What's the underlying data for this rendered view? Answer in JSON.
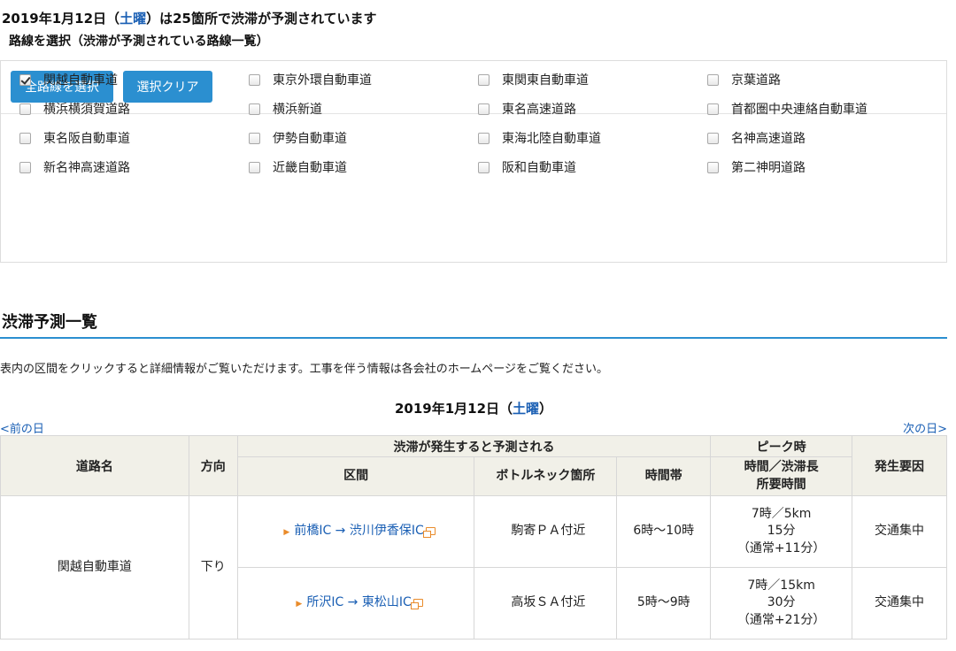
{
  "header": {
    "date_text": "2019年1月12日（",
    "day_of_week": "土曜",
    "summary": "）は25箇所で渋滞が予測されています",
    "subtitle": "路線を選択（渋滞が予測されている路線一覧）"
  },
  "route_select": {
    "select_all_label": "全路線を選択",
    "clear_label": "選択クリア",
    "routes": [
      {
        "label": "関越自動車道",
        "checked": true
      },
      {
        "label": "東京外環自動車道",
        "checked": false
      },
      {
        "label": "東関東自動車道",
        "checked": false
      },
      {
        "label": "京葉道路",
        "checked": false
      },
      {
        "label": "横浜横須賀道路",
        "checked": false
      },
      {
        "label": "横浜新道",
        "checked": false
      },
      {
        "label": "東名高速道路",
        "checked": false
      },
      {
        "label": "首都圏中央連絡自動車道",
        "checked": false
      },
      {
        "label": "東名阪自動車道",
        "checked": false
      },
      {
        "label": "伊勢自動車道",
        "checked": false
      },
      {
        "label": "東海北陸自動車道",
        "checked": false
      },
      {
        "label": "名神高速道路",
        "checked": false
      },
      {
        "label": "新名神高速道路",
        "checked": false
      },
      {
        "label": "近畿自動車道",
        "checked": false
      },
      {
        "label": "阪和自動車道",
        "checked": false
      },
      {
        "label": "第二神明道路",
        "checked": false
      }
    ]
  },
  "forecast": {
    "section_title": "渋滞予測一覧",
    "notice": "表内の区間をクリックすると詳細情報がご覧いただけます。工事を伴う情報は各会社のホームページをご覧ください。",
    "date_text": "2019年1月12日（",
    "day_of_week": "土曜",
    "date_suffix": "）",
    "prev_label": "<前の日",
    "next_label": "次の日>",
    "headers": {
      "road": "道路名",
      "direction": "方向",
      "group_predicted": "渋滞が発生すると予測される",
      "section": "区間",
      "bottleneck": "ボトルネック箇所",
      "time_band": "時間帯",
      "group_peak": "ピーク時",
      "peak_line1": "時間／渋滞長",
      "peak_line2": "所要時間",
      "cause": "発生要因"
    },
    "road_name": "関越自動車道",
    "direction": "下り",
    "rows": [
      {
        "section": "前橋IC → 渋川伊香保IC",
        "bottleneck": "駒寄ＰＡ付近",
        "time_band": "6時〜10時",
        "peak_length": "7時／5km",
        "peak_duration": "15分",
        "peak_normal": "（通常+11分）",
        "cause": "交通集中"
      },
      {
        "section": "所沢IC → 東松山IC",
        "bottleneck": "高坂ＳＡ付近",
        "time_band": "5時〜9時",
        "peak_length": "7時／15km",
        "peak_duration": "30分",
        "peak_normal": "（通常+21分）",
        "cause": "交通集中"
      }
    ]
  }
}
